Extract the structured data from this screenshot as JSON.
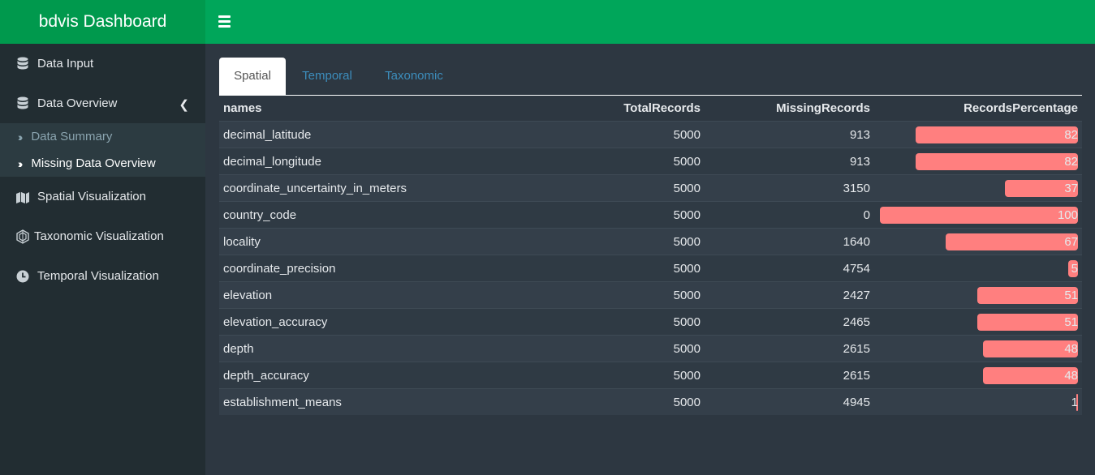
{
  "app": {
    "title": "bdvis Dashboard"
  },
  "sidebar": {
    "items": [
      {
        "label": "Data Input",
        "icon": "database-icon"
      },
      {
        "label": "Data Overview",
        "icon": "database-icon"
      },
      {
        "label": "Spatial Visualization",
        "icon": "map-icon"
      },
      {
        "label": "Taxonomic Visualization",
        "icon": "tree-icon"
      },
      {
        "label": "Temporal Visualization",
        "icon": "clock-icon"
      }
    ],
    "submenu": [
      {
        "label": "Data Summary",
        "active": false
      },
      {
        "label": "Missing Data Overview",
        "active": true
      }
    ]
  },
  "tabs": [
    {
      "label": "Spatial",
      "active": true
    },
    {
      "label": "Temporal",
      "active": false
    },
    {
      "label": "Taxonomic",
      "active": false
    }
  ],
  "table": {
    "headers": [
      "names",
      "TotalRecords",
      "MissingRecords",
      "RecordsPercentage"
    ],
    "rows": [
      {
        "name": "decimal_latitude",
        "total": "5000",
        "missing": "913",
        "pct": 82
      },
      {
        "name": "decimal_longitude",
        "total": "5000",
        "missing": "913",
        "pct": 82
      },
      {
        "name": "coordinate_uncertainty_in_meters",
        "total": "5000",
        "missing": "3150",
        "pct": 37
      },
      {
        "name": "country_code",
        "total": "5000",
        "missing": "0",
        "pct": 100
      },
      {
        "name": "locality",
        "total": "5000",
        "missing": "1640",
        "pct": 67
      },
      {
        "name": "coordinate_precision",
        "total": "5000",
        "missing": "4754",
        "pct": 5
      },
      {
        "name": "elevation",
        "total": "5000",
        "missing": "2427",
        "pct": 51
      },
      {
        "name": "elevation_accuracy",
        "total": "5000",
        "missing": "2465",
        "pct": 51
      },
      {
        "name": "depth",
        "total": "5000",
        "missing": "2615",
        "pct": 48
      },
      {
        "name": "depth_accuracy",
        "total": "5000",
        "missing": "2615",
        "pct": 48
      },
      {
        "name": "establishment_means",
        "total": "5000",
        "missing": "4945",
        "pct": 1
      }
    ]
  },
  "colors": {
    "header": "#00a65a",
    "logo": "#00994d",
    "sidebar": "#222d32",
    "content": "#2d3741",
    "bar": "#ff7f7f",
    "link": "#3c8dbc"
  }
}
